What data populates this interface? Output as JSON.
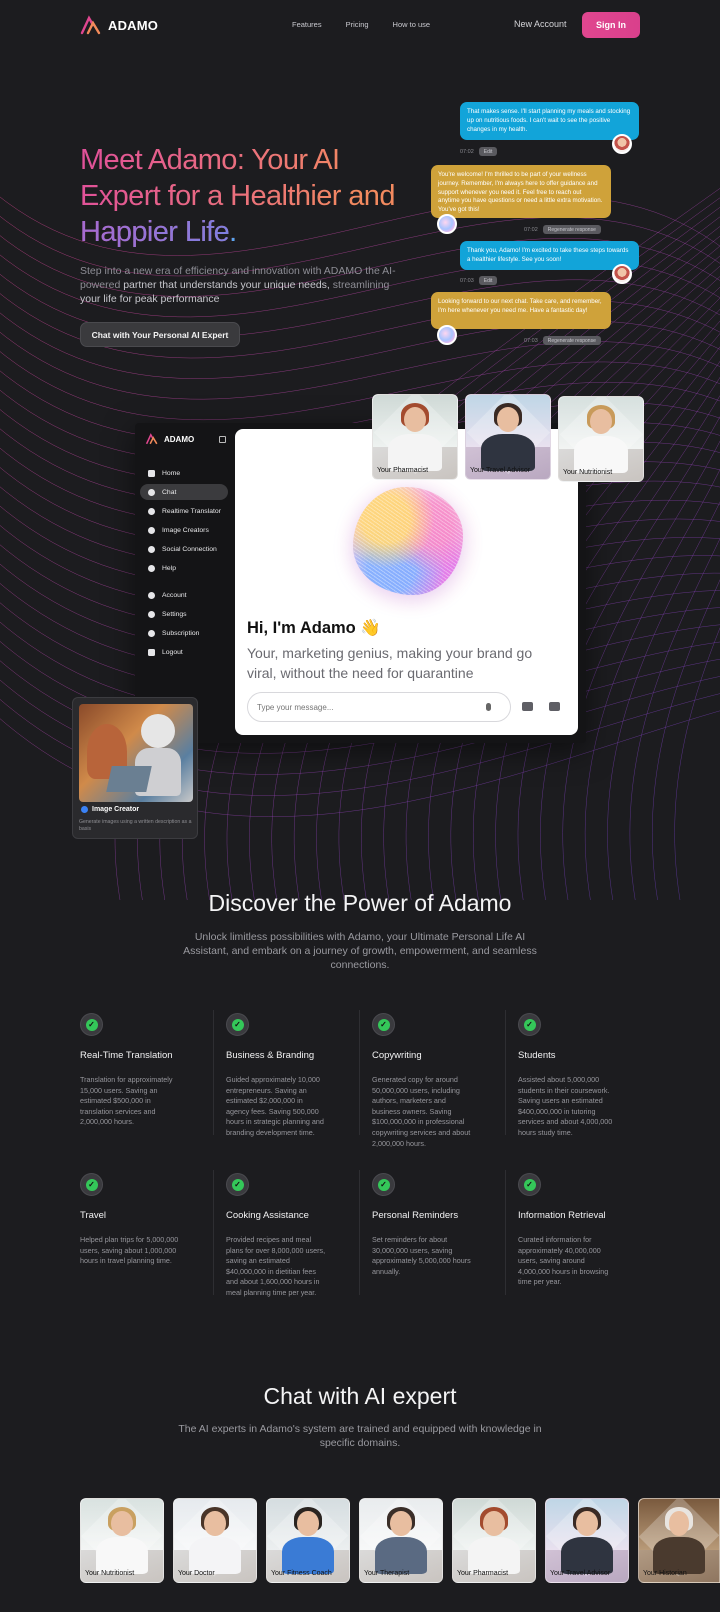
{
  "nav": {
    "brand": "ADAMO",
    "links": [
      "Features",
      "Pricing",
      "How to use"
    ],
    "new_account": "New Account",
    "sign_in": "Sign In"
  },
  "hero": {
    "title_line1": "Meet Adamo: Your AI",
    "title_line2": "Expert for a Healthier and",
    "title_line3": "Happier Life",
    "title_dot": ".",
    "subtitle_1": "Step into a new era of efficiency and innovation with ADAMO the AI-powered ",
    "subtitle_2": "partner that understands your unique needs,",
    "subtitle_3": " streamlining ",
    "subtitle_4": "your life for peak performance",
    "cta": "Chat with Your Personal AI Expert"
  },
  "chat": {
    "messages": [
      {
        "role": "user",
        "text": "That makes sense. I'll start planning my meals and stocking up on nutritious foods. I can't wait to see the positive changes in my health.",
        "time": "07:02",
        "action": "Edit"
      },
      {
        "role": "ai",
        "text": "You're welcome! I'm thrilled to be part of your wellness journey. Remember, I'm always here to offer guidance and support whenever you need it. Feel free to reach out anytime you have questions or need a little extra motivation. You've got this!",
        "time": "07:02",
        "action": "Regenerate response"
      },
      {
        "role": "user",
        "text": "Thank you, Adamo! I'm excited to take these steps towards a healthier lifestyle. See you soon!",
        "time": "07:03",
        "action": "Edit"
      },
      {
        "role": "ai",
        "text": "Looking forward to our next chat. Take care, and remember, I'm here whenever you need me. Have a fantastic day!",
        "time": "07:03",
        "action": "Regenerate response"
      }
    ]
  },
  "app": {
    "brand": "ADAMO",
    "sidebar": [
      {
        "label": "Home",
        "icon": "home-icon"
      },
      {
        "label": "Chat",
        "icon": "chat-icon"
      },
      {
        "label": "Realtime Translator",
        "icon": "translate-icon"
      },
      {
        "label": "Image Creators",
        "icon": "palette-icon"
      },
      {
        "label": "Social Connection",
        "icon": "link-icon"
      },
      {
        "label": "Help",
        "icon": "help-icon"
      },
      {
        "label": "Account",
        "icon": "account-icon"
      },
      {
        "label": "Settings",
        "icon": "settings-icon"
      },
      {
        "label": "Subscription",
        "icon": "subscription-icon"
      },
      {
        "label": "Logout",
        "icon": "logout-icon"
      }
    ],
    "active_item": "Chat",
    "greeting": "Hi, I'm Adamo 👋",
    "tagline": "Your, marketing genius, making your brand go viral, without the need for quarantine",
    "input_placeholder": "Type your message..."
  },
  "hero_experts": [
    "Your Pharmacist",
    "Your Travel Advisor",
    "Your Nutritionist"
  ],
  "image_creator": {
    "title": "Image Creator",
    "description": "Generate images using a written description as a basis"
  },
  "discover": {
    "title": "Discover the Power of Adamo",
    "subtitle": "Unlock limitless possibilities with Adamo, your Ultimate Personal Life AI Assistant, and embark on a journey of growth, empowerment, and seamless connections.",
    "features": [
      {
        "title": "Real-Time Translation",
        "text": "Translation for approximately 15,000 users. Saving an estimated $500,000 in translation services and 2,000,000 hours."
      },
      {
        "title": "Business & Branding",
        "text": "Guided approximately 10,000 entrepreneurs. Saving an estimated $2,000,000 in agency fees. Saving 500,000 hours in strategic planning and branding development time."
      },
      {
        "title": "Copywriting",
        "text": "Generated copy for around 50,000,000 users, including authors, marketers and business owners. Saving $100,000,000 in professional copywriting services and about 2,000,000 hours."
      },
      {
        "title": "Students",
        "text": "Assisted about 5,000,000 students in their coursework. Saving users an estimated $400,000,000 in tutoring services and about 4,000,000 hours study time."
      },
      {
        "title": "Travel",
        "text": "Helped plan trips for 5,000,000 users, saving about 1,000,000 hours in travel planning time."
      },
      {
        "title": "Cooking Assistance",
        "text": "Provided recipes and meal plans for over 8,000,000 users, saving an estimated $40,000,000 in dietitian fees and about 1,600,000 hours in meal planning time per year."
      },
      {
        "title": "Personal Reminders",
        "text": "Set reminders for about 30,000,000 users, saving approximately 5,000,000 hours annually."
      },
      {
        "title": "Information Retrieval",
        "text": "Curated information for approximately 40,000,000 users, saving around 4,000,000 hours in browsing time per year."
      }
    ]
  },
  "experts_section": {
    "title": "Chat with AI expert",
    "subtitle": "The AI experts in Adamo's system are trained and equipped with knowledge in specific domains.",
    "experts": [
      "Your Nutritionist",
      "Your Doctor",
      "Your Fitness Coach",
      "Your Therapist",
      "Your Pharmacist",
      "Your Travel Advisor",
      "Your Historian"
    ]
  },
  "colors": {
    "accent_pink": "#e0468f",
    "user_bubble": "#12a4d9",
    "ai_bubble": "#cfa23a",
    "check_green": "#34c759",
    "background": "#1c1c1f"
  }
}
